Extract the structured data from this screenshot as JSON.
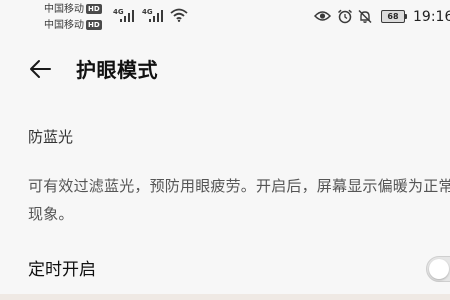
{
  "status_bar": {
    "carrier_1": "中国移动",
    "carrier_2": "中国移动",
    "hd_badge": "HD",
    "network_type": "4G",
    "battery": "68",
    "time": "19:16",
    "icons": [
      "signal-bars-icon",
      "wifi-icon",
      "eye-icon",
      "alarm-icon",
      "mute-icon",
      "battery-icon"
    ]
  },
  "header": {
    "back_icon": "back-arrow-icon",
    "title": "护眼模式"
  },
  "content": {
    "section_title": "防蓝光",
    "description": "可有效过滤蓝光，预防用眼疲劳。开启后，屏幕显示偏暖为正常现象。",
    "timer_label": "定时开启",
    "timer_enabled": false
  },
  "colors": {
    "background": "#f7f7f7",
    "primary_text": "#1f1f1f",
    "secondary_text": "#555555",
    "toggle_off": "#e6e6e6"
  }
}
